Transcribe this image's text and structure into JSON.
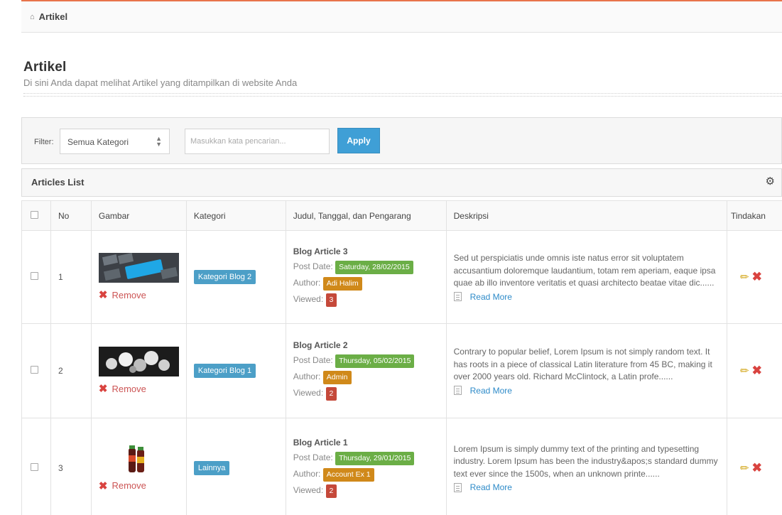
{
  "breadcrumb": {
    "label": "Artikel"
  },
  "header": {
    "title": "Artikel",
    "subtitle": "Di sini Anda dapat melihat Artikel yang ditampilkan di website Anda"
  },
  "filter": {
    "label": "Filter:",
    "category_selected": "Semua Kategori",
    "search_placeholder": "Masukkan kata pencarian...",
    "apply_label": "Apply"
  },
  "panel": {
    "title": "Articles List"
  },
  "table": {
    "columns": {
      "no": "No",
      "image": "Gambar",
      "category": "Kategori",
      "title": "Judul, Tanggal, dan Pengarang",
      "description": "Deskripsi",
      "actions": "Tindakan"
    },
    "rows": [
      {
        "no": "1",
        "remove_label": "Remove",
        "category": "Kategori Blog 2",
        "title": "Blog Article 3",
        "post_date_label": "Post Date:",
        "post_date": "Saturday, 28/02/2015",
        "author_label": "Author:",
        "author": "Adi Halim",
        "viewed_label": "Viewed:",
        "viewed": "3",
        "description": "Sed ut perspiciatis unde omnis iste natus error sit voluptatem accusantium doloremque laudantium, totam rem aperiam, eaque ipsa quae ab illo inventore veritatis et quasi architecto beatae vitae dic......",
        "read_more": "Read More"
      },
      {
        "no": "2",
        "remove_label": "Remove",
        "category": "Kategori Blog 1",
        "title": "Blog Article 2",
        "post_date_label": "Post Date:",
        "post_date": "Thursday, 05/02/2015",
        "author_label": "Author:",
        "author": "Admin",
        "viewed_label": "Viewed:",
        "viewed": "2",
        "description": "Contrary to popular belief, Lorem Ipsum is not simply random text. It has roots in a piece of classical Latin literature from 45 BC, making it over 2000 years old. Richard McClintock, a Latin profe......",
        "read_more": "Read More"
      },
      {
        "no": "3",
        "remove_label": "Remove",
        "category": "Lainnya",
        "title": "Blog Article 1",
        "post_date_label": "Post Date:",
        "post_date": "Thursday, 29/01/2015",
        "author_label": "Author:",
        "author": "Account Ex 1",
        "viewed_label": "Viewed:",
        "viewed": "2",
        "description": "Lorem Ipsum is simply dummy text of the printing and typesetting industry. Lorem Ipsum has been the industry&apos;s standard dummy text ever since the 1500s, when an unknown printe......",
        "read_more": "Read More"
      }
    ]
  },
  "icons": {
    "breadcrumb": "home-icon",
    "panel": "gear-icon",
    "remove": "close-icon",
    "read_more": "document-icon",
    "edit": "pencil-icon",
    "delete": "delete-icon"
  },
  "colors": {
    "accent_top": "#e8734a",
    "apply_button": "#3f9fd6",
    "category_label": "#4c9fc7",
    "date_label": "#6bae46",
    "author_label": "#d0891a",
    "viewed_label": "#c5493a"
  }
}
